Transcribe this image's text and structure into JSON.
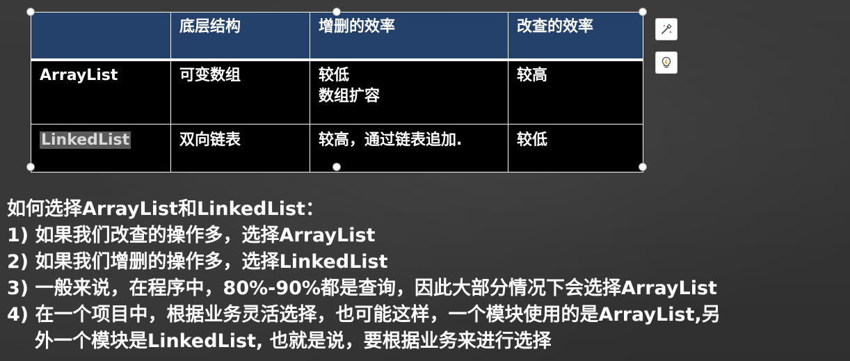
{
  "table": {
    "header": [
      "",
      "底层结构",
      "增删的效率",
      "改查的效率"
    ],
    "rows": [
      {
        "name": "ArrayList",
        "structure": "可变数组",
        "add_delete": "较低\n数组扩容",
        "query": "较高"
      },
      {
        "name": "LinkedList",
        "structure": "双向链表",
        "add_delete": "较高，通过链表追加.",
        "query": "较低"
      }
    ]
  },
  "toolbar": {
    "design_icon": "magic-wand-icon",
    "ideas_icon": "lightbulb-icon"
  },
  "notes": {
    "title": "如何选择ArrayList和LinkedList：",
    "items": [
      "1) 如果我们改查的操作多，选择ArrayList",
      "2) 如果我们增删的操作多，选择LinkedList",
      "3) 一般来说，在程序中，80%-90%都是查询，因此大部分情况下会选择ArrayList",
      "4) 在一个项目中，根据业务灵活选择，也可能这样，一个模块使用的是ArrayList,另",
      "外一个模块是LinkedList, 也就是说，要根据业务来进行选择"
    ]
  },
  "colors": {
    "header_bg": "#23416b",
    "cell_bg": "#000000",
    "slide_bg": "#363636"
  }
}
